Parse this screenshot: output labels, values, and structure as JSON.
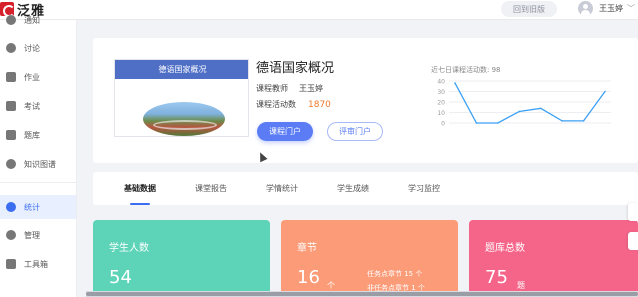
{
  "header": {
    "logo_text": "泛雅",
    "old_version_label": "回到旧版",
    "user_name": "王玉婷",
    "user_caret": "﹀"
  },
  "sidebar": {
    "items": [
      {
        "label": "通知",
        "icon": "bell-icon"
      },
      {
        "label": "讨论",
        "icon": "chat-icon"
      },
      {
        "label": "作业",
        "icon": "edit-icon"
      },
      {
        "label": "考试",
        "icon": "exam-icon"
      },
      {
        "label": "题库",
        "icon": "database-icon"
      },
      {
        "label": "知识图谱",
        "icon": "graph-icon"
      },
      {
        "label": "统计",
        "icon": "pie-chart-icon",
        "active": true
      },
      {
        "label": "管理",
        "icon": "gear-icon"
      },
      {
        "label": "工具箱",
        "icon": "toolbox-icon"
      }
    ]
  },
  "course": {
    "cover_title": "德语国家概况",
    "title": "德语国家概况",
    "teacher_label": "课程教师",
    "teacher_name": "王玉婷",
    "activity_label": "课程活动数",
    "activity_count": "1870",
    "portal_button": "课程门户",
    "review_button": "评审门户"
  },
  "activity_chart_title": "近七日课程活动数: 98",
  "chart_data": {
    "type": "line",
    "title": "近七日课程活动数: 98",
    "x": [
      1,
      2,
      3,
      4,
      5,
      6,
      7,
      8
    ],
    "y": [
      38,
      0,
      0,
      11,
      14,
      2,
      2,
      30
    ],
    "ylim": [
      0,
      40
    ],
    "yticks": [
      "40",
      "30",
      "20",
      "10",
      "0"
    ],
    "grid": true,
    "color": "#3aa0f5"
  },
  "tabs": [
    "基础数据",
    "课堂报告",
    "学情统计",
    "学生成绩",
    "学习监控"
  ],
  "stats": [
    {
      "title": "学生人数",
      "value": "54",
      "color": "#5dd4b8"
    },
    {
      "title": "章节",
      "value": "16",
      "arrow": "个",
      "detail1": "任务点章节 15 个",
      "detail2": "非任务点章节 1 个",
      "color": "#fb9b78"
    },
    {
      "title": "题库总数",
      "value": "75",
      "arrow": "题",
      "color": "#f5658a"
    }
  ]
}
